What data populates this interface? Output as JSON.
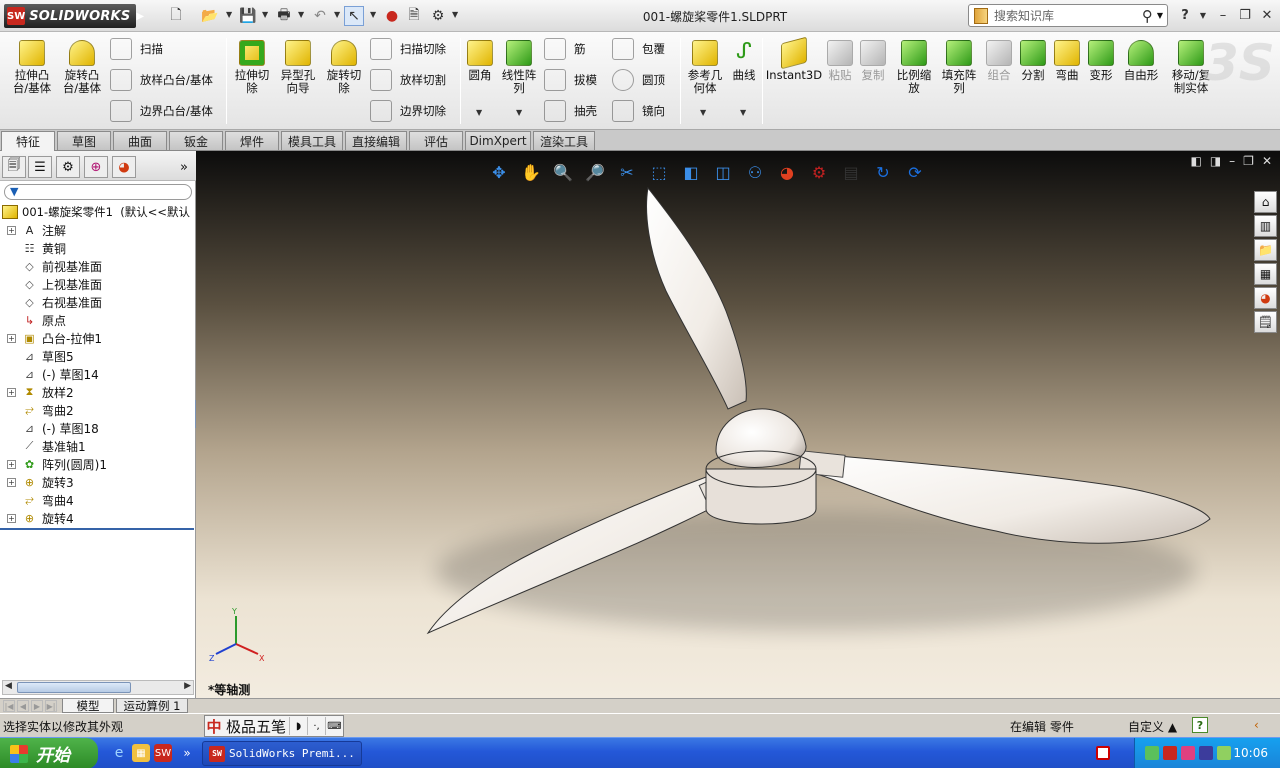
{
  "app": {
    "logo_text": "SOLIDWORKS",
    "logo_badge": "SW",
    "document_title": "001-螺旋桨零件1.SLDPRT",
    "search_placeholder": "搜索知识库",
    "help_label": "?"
  },
  "quick_access": [
    "new-doc-icon",
    "open-icon",
    "save-icon",
    "print-icon",
    "undo-icon",
    "select-icon",
    "rebuild-icon",
    "file-props-icon",
    "options-icon"
  ],
  "commands": {
    "extrude_boss": "拉伸凸\n台/基体",
    "revolve_boss": "旋转凸\n台/基体",
    "sweep": "扫描",
    "loft_boss": "放样凸台/基体",
    "boundary_boss": "边界凸台/基体",
    "extrude_cut": "拉伸切\n除",
    "hole_wizard": "异型孔\n向导",
    "revolve_cut": "旋转切\n除",
    "sweep_cut": "扫描切除",
    "loft_cut": "放样切割",
    "boundary_cut": "边界切除",
    "fillet": "圆角",
    "linear_pattern": "线性阵\n列",
    "rib": "筋",
    "draft": "拔模",
    "shell": "抽壳",
    "wrap": "包覆",
    "dome": "圆顶",
    "mirror": "镜向",
    "ref_geometry": "参考几\n何体",
    "curves": "曲线",
    "instant3d": "Instant3D",
    "paste": "粘贴",
    "copy": "复制",
    "scale": "比例缩\n放",
    "fill_pattern": "填充阵\n列",
    "combine": "组合",
    "split": "分割",
    "flex": "弯曲",
    "deform": "变形",
    "freeform": "自由形",
    "move_copy": "移动/复\n制实体"
  },
  "tabs": [
    "特征",
    "草图",
    "曲面",
    "钣金",
    "焊件",
    "模具工具",
    "直接编辑",
    "评估",
    "DimXpert",
    "渲染工具"
  ],
  "active_tab": "特征",
  "feature_tree": {
    "root": "001-螺旋桨零件1  (默认<<默认",
    "items": [
      {
        "label": "注解",
        "icon": "annotation-icon",
        "expandable": true
      },
      {
        "label": "黄铜",
        "icon": "material-icon",
        "expandable": false
      },
      {
        "label": "前视基准面",
        "icon": "plane-icon",
        "expandable": false
      },
      {
        "label": "上视基准面",
        "icon": "plane-icon",
        "expandable": false
      },
      {
        "label": "右视基准面",
        "icon": "plane-icon",
        "expandable": false
      },
      {
        "label": "原点",
        "icon": "origin-icon",
        "expandable": false
      },
      {
        "label": "凸台-拉伸1",
        "icon": "extrude-icon",
        "expandable": true
      },
      {
        "label": "草图5",
        "icon": "sketch-icon",
        "expandable": false
      },
      {
        "label": "(-) 草图14",
        "icon": "sketch-icon",
        "expandable": false
      },
      {
        "label": "放样2",
        "icon": "loft-icon",
        "expandable": true
      },
      {
        "label": "弯曲2",
        "icon": "flex-icon",
        "expandable": false
      },
      {
        "label": "(-) 草图18",
        "icon": "sketch-icon",
        "expandable": false
      },
      {
        "label": "基准轴1",
        "icon": "axis-icon",
        "expandable": false
      },
      {
        "label": "阵列(圆周)1",
        "icon": "circular-pattern-icon",
        "expandable": true
      },
      {
        "label": "旋转3",
        "icon": "revolve-icon",
        "expandable": true
      },
      {
        "label": "弯曲4",
        "icon": "flex-icon",
        "expandable": false
      },
      {
        "label": "旋转4",
        "icon": "revolve-icon",
        "expandable": true
      }
    ]
  },
  "model_tabs": [
    "模型",
    "运动算例 1"
  ],
  "viewport": {
    "view_name": "*等轴测",
    "triad_labels": {
      "x": "X",
      "y": "Y",
      "z": "Z"
    }
  },
  "status": {
    "left": "选择实体以修改其外观",
    "ime_name": "极品五笔",
    "mode": "在编辑 零件",
    "unit": "自定义 ▲"
  },
  "taskbar": {
    "start": "开始",
    "task_label": "SolidWorks Premi...",
    "clock": "10:06"
  },
  "colors": {
    "brand_red": "#c8281e",
    "xp_blue": "#2458d8",
    "start_green": "#3b9e34",
    "viewport_top": "#0c0c0c",
    "viewport_bottom": "#f3ece0"
  }
}
